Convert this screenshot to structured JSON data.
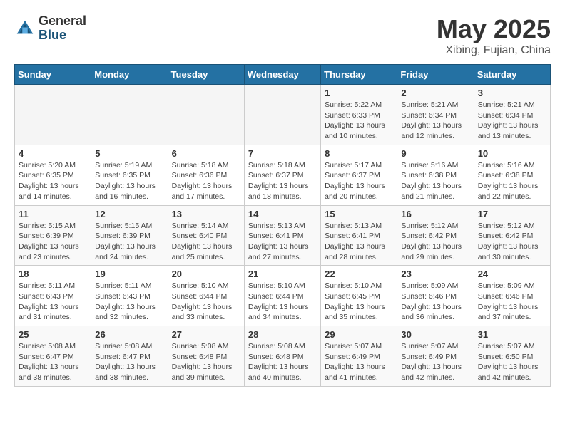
{
  "header": {
    "logo_general": "General",
    "logo_blue": "Blue",
    "month_year": "May 2025",
    "location": "Xibing, Fujian, China"
  },
  "days_of_week": [
    "Sunday",
    "Monday",
    "Tuesday",
    "Wednesday",
    "Thursday",
    "Friday",
    "Saturday"
  ],
  "weeks": [
    [
      {
        "day": "",
        "info": ""
      },
      {
        "day": "",
        "info": ""
      },
      {
        "day": "",
        "info": ""
      },
      {
        "day": "",
        "info": ""
      },
      {
        "day": "1",
        "info": "Sunrise: 5:22 AM\nSunset: 6:33 PM\nDaylight: 13 hours\nand 10 minutes."
      },
      {
        "day": "2",
        "info": "Sunrise: 5:21 AM\nSunset: 6:34 PM\nDaylight: 13 hours\nand 12 minutes."
      },
      {
        "day": "3",
        "info": "Sunrise: 5:21 AM\nSunset: 6:34 PM\nDaylight: 13 hours\nand 13 minutes."
      }
    ],
    [
      {
        "day": "4",
        "info": "Sunrise: 5:20 AM\nSunset: 6:35 PM\nDaylight: 13 hours\nand 14 minutes."
      },
      {
        "day": "5",
        "info": "Sunrise: 5:19 AM\nSunset: 6:35 PM\nDaylight: 13 hours\nand 16 minutes."
      },
      {
        "day": "6",
        "info": "Sunrise: 5:18 AM\nSunset: 6:36 PM\nDaylight: 13 hours\nand 17 minutes."
      },
      {
        "day": "7",
        "info": "Sunrise: 5:18 AM\nSunset: 6:37 PM\nDaylight: 13 hours\nand 18 minutes."
      },
      {
        "day": "8",
        "info": "Sunrise: 5:17 AM\nSunset: 6:37 PM\nDaylight: 13 hours\nand 20 minutes."
      },
      {
        "day": "9",
        "info": "Sunrise: 5:16 AM\nSunset: 6:38 PM\nDaylight: 13 hours\nand 21 minutes."
      },
      {
        "day": "10",
        "info": "Sunrise: 5:16 AM\nSunset: 6:38 PM\nDaylight: 13 hours\nand 22 minutes."
      }
    ],
    [
      {
        "day": "11",
        "info": "Sunrise: 5:15 AM\nSunset: 6:39 PM\nDaylight: 13 hours\nand 23 minutes."
      },
      {
        "day": "12",
        "info": "Sunrise: 5:15 AM\nSunset: 6:39 PM\nDaylight: 13 hours\nand 24 minutes."
      },
      {
        "day": "13",
        "info": "Sunrise: 5:14 AM\nSunset: 6:40 PM\nDaylight: 13 hours\nand 25 minutes."
      },
      {
        "day": "14",
        "info": "Sunrise: 5:13 AM\nSunset: 6:41 PM\nDaylight: 13 hours\nand 27 minutes."
      },
      {
        "day": "15",
        "info": "Sunrise: 5:13 AM\nSunset: 6:41 PM\nDaylight: 13 hours\nand 28 minutes."
      },
      {
        "day": "16",
        "info": "Sunrise: 5:12 AM\nSunset: 6:42 PM\nDaylight: 13 hours\nand 29 minutes."
      },
      {
        "day": "17",
        "info": "Sunrise: 5:12 AM\nSunset: 6:42 PM\nDaylight: 13 hours\nand 30 minutes."
      }
    ],
    [
      {
        "day": "18",
        "info": "Sunrise: 5:11 AM\nSunset: 6:43 PM\nDaylight: 13 hours\nand 31 minutes."
      },
      {
        "day": "19",
        "info": "Sunrise: 5:11 AM\nSunset: 6:43 PM\nDaylight: 13 hours\nand 32 minutes."
      },
      {
        "day": "20",
        "info": "Sunrise: 5:10 AM\nSunset: 6:44 PM\nDaylight: 13 hours\nand 33 minutes."
      },
      {
        "day": "21",
        "info": "Sunrise: 5:10 AM\nSunset: 6:44 PM\nDaylight: 13 hours\nand 34 minutes."
      },
      {
        "day": "22",
        "info": "Sunrise: 5:10 AM\nSunset: 6:45 PM\nDaylight: 13 hours\nand 35 minutes."
      },
      {
        "day": "23",
        "info": "Sunrise: 5:09 AM\nSunset: 6:46 PM\nDaylight: 13 hours\nand 36 minutes."
      },
      {
        "day": "24",
        "info": "Sunrise: 5:09 AM\nSunset: 6:46 PM\nDaylight: 13 hours\nand 37 minutes."
      }
    ],
    [
      {
        "day": "25",
        "info": "Sunrise: 5:08 AM\nSunset: 6:47 PM\nDaylight: 13 hours\nand 38 minutes."
      },
      {
        "day": "26",
        "info": "Sunrise: 5:08 AM\nSunset: 6:47 PM\nDaylight: 13 hours\nand 38 minutes."
      },
      {
        "day": "27",
        "info": "Sunrise: 5:08 AM\nSunset: 6:48 PM\nDaylight: 13 hours\nand 39 minutes."
      },
      {
        "day": "28",
        "info": "Sunrise: 5:08 AM\nSunset: 6:48 PM\nDaylight: 13 hours\nand 40 minutes."
      },
      {
        "day": "29",
        "info": "Sunrise: 5:07 AM\nSunset: 6:49 PM\nDaylight: 13 hours\nand 41 minutes."
      },
      {
        "day": "30",
        "info": "Sunrise: 5:07 AM\nSunset: 6:49 PM\nDaylight: 13 hours\nand 42 minutes."
      },
      {
        "day": "31",
        "info": "Sunrise: 5:07 AM\nSunset: 6:50 PM\nDaylight: 13 hours\nand 42 minutes."
      }
    ]
  ]
}
